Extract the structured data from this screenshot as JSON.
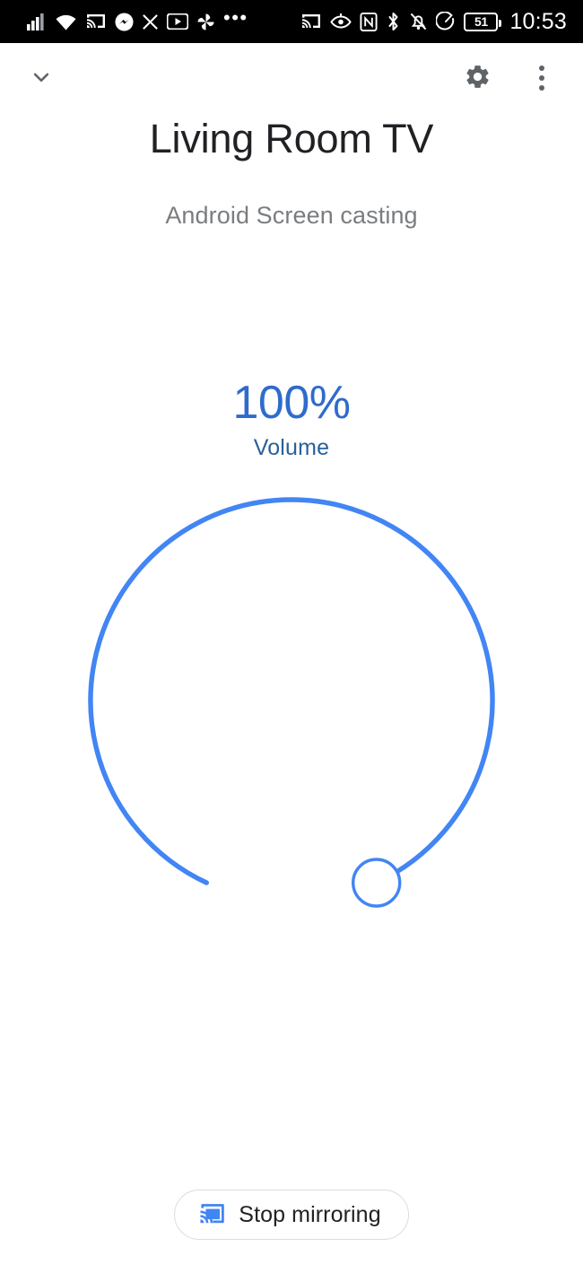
{
  "status_bar": {
    "time": "10:53",
    "battery_level": "51",
    "left_icons": [
      {
        "name": "cellular-signal-icon",
        "label": "Cellular signal"
      },
      {
        "name": "wifi-icon",
        "label": "Wi-Fi"
      },
      {
        "name": "cast-active-icon",
        "label": "Casting"
      },
      {
        "name": "messenger-icon",
        "label": "Messenger notification"
      },
      {
        "name": "x-twitter-icon",
        "label": "X notification"
      },
      {
        "name": "youtube-icon",
        "label": "YouTube notification"
      },
      {
        "name": "pinwheel-icon",
        "label": "App notification"
      },
      {
        "name": "more-notifications-icon",
        "label": "More notifications"
      }
    ],
    "right_icons": [
      {
        "name": "cast-icon",
        "label": "Cast"
      },
      {
        "name": "eye-comfort-icon",
        "label": "Eye comfort shield"
      },
      {
        "name": "nfc-icon",
        "label": "NFC"
      },
      {
        "name": "bluetooth-icon",
        "label": "Bluetooth"
      },
      {
        "name": "notifications-off-icon",
        "label": "Mute"
      },
      {
        "name": "data-saver-icon",
        "label": "Data saver"
      },
      {
        "name": "battery-icon",
        "label": "Battery"
      }
    ]
  },
  "app_bar": {
    "collapse_label": "Collapse",
    "settings_label": "Settings",
    "overflow_label": "More options"
  },
  "device": {
    "title": "Living Room TV",
    "subtitle": "Android Screen casting"
  },
  "volume": {
    "percent_label": "100%",
    "value": 100,
    "min": 0,
    "max": 100,
    "label": "Volume",
    "track_color": "#4285f4",
    "thumb_fill": "#ffffff",
    "text_color": "#2f6bcc"
  },
  "actions": {
    "stop_mirroring_label": "Stop mirroring"
  }
}
